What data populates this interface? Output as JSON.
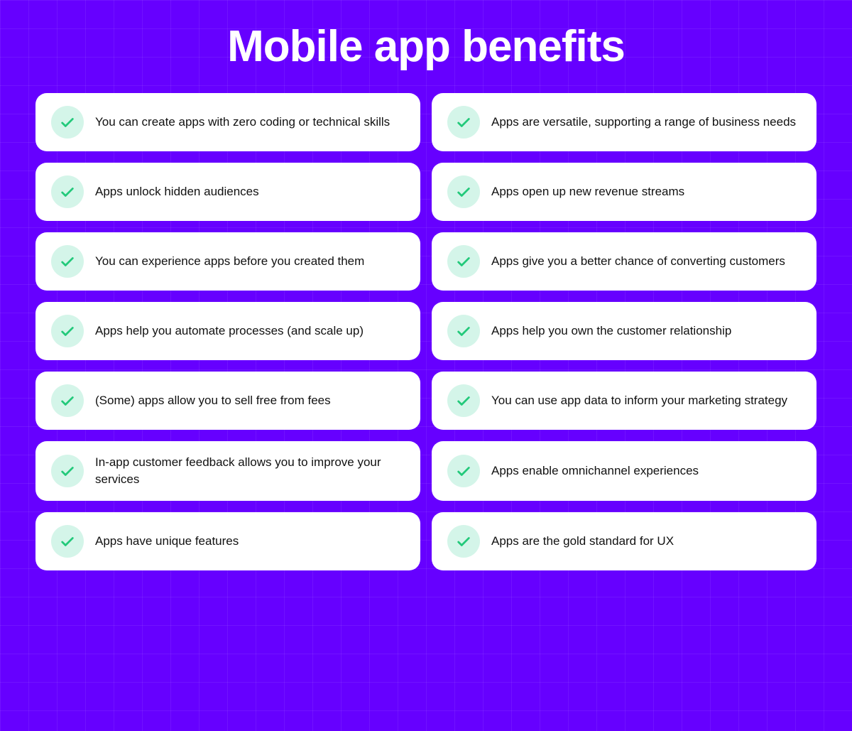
{
  "title": "Mobile app benefits",
  "items": [
    {
      "id": 1,
      "text": "You can create apps with zero coding or technical skills"
    },
    {
      "id": 2,
      "text": "Apps are versatile, supporting a range of business needs"
    },
    {
      "id": 3,
      "text": "Apps unlock hidden audiences"
    },
    {
      "id": 4,
      "text": "Apps open up new revenue streams"
    },
    {
      "id": 5,
      "text": "You can experience apps before you created them"
    },
    {
      "id": 6,
      "text": "Apps give you a better chance of converting customers"
    },
    {
      "id": 7,
      "text": "Apps help you automate processes (and scale up)"
    },
    {
      "id": 8,
      "text": "Apps help you own the customer relationship"
    },
    {
      "id": 9,
      "text": "(Some) apps allow you to sell free from fees"
    },
    {
      "id": 10,
      "text": "You can use app data to inform your marketing strategy"
    },
    {
      "id": 11,
      "text": "In-app customer feedback allows you to improve your services"
    },
    {
      "id": 12,
      "text": "Apps enable omnichannel experiences"
    },
    {
      "id": 13,
      "text": "Apps have unique features"
    },
    {
      "id": 14,
      "text": "Apps are the gold standard for UX"
    }
  ],
  "checkmark_color": "#22c97a"
}
